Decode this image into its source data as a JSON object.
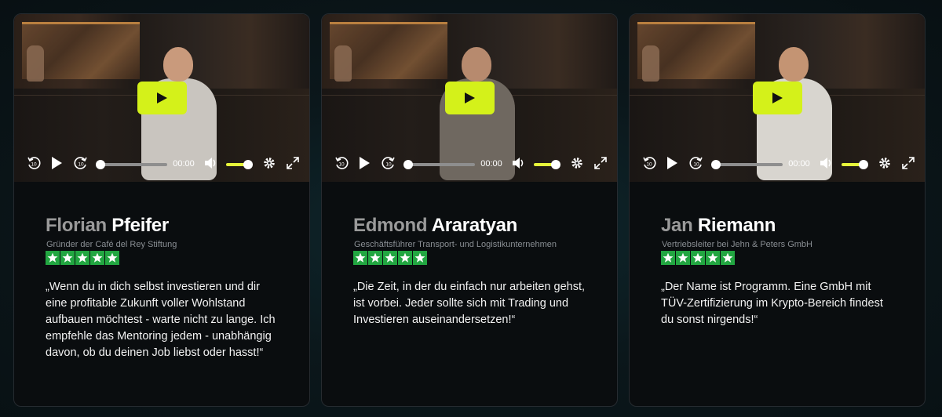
{
  "video_player": {
    "time": "00:00",
    "controls": {
      "rewind_icon": "rewind-10-icon",
      "play_icon": "play-icon",
      "forward_icon": "forward-10-icon",
      "volume_icon": "volume-icon",
      "settings_icon": "gear-icon",
      "fullscreen_icon": "fullscreen-icon"
    },
    "volume_level": 1.0,
    "progress": 0.0
  },
  "colors": {
    "accent": "#d4f11a",
    "star_green": "#22a641",
    "card_bg": "#0a0d0f",
    "page_bg": "#0b171b"
  },
  "testimonials": [
    {
      "first_name": "Florian",
      "last_name": "Pfeifer",
      "role": "Gründer der Café del Rey Stiftung",
      "rating": 5,
      "quote": "„Wenn du in dich selbst investieren und dir eine profitable Zukunft voller Wohlstand aufbauen möchtest - warte nicht zu lange. Ich empfehle das Mentoring jedem - unabhängig davon, ob du deinen Job liebst oder hasst!“"
    },
    {
      "first_name": "Edmond",
      "last_name": "Araratyan",
      "role": "Geschäftsführer Transport- und Logistikunternehmen",
      "rating": 5,
      "quote": "„Die Zeit, in der du einfach nur arbeiten gehst, ist vorbei. Jeder sollte sich mit Trading und Investieren auseinandersetzen!“"
    },
    {
      "first_name": "Jan",
      "last_name": "Riemann",
      "role": "Vertriebsleiter bei Jehn & Peters GmbH",
      "rating": 5,
      "quote": "„Der Name ist Programm. Eine GmbH mit TÜV-Zertifizierung im Krypto-Bereich findest du sonst nirgends!“"
    }
  ]
}
